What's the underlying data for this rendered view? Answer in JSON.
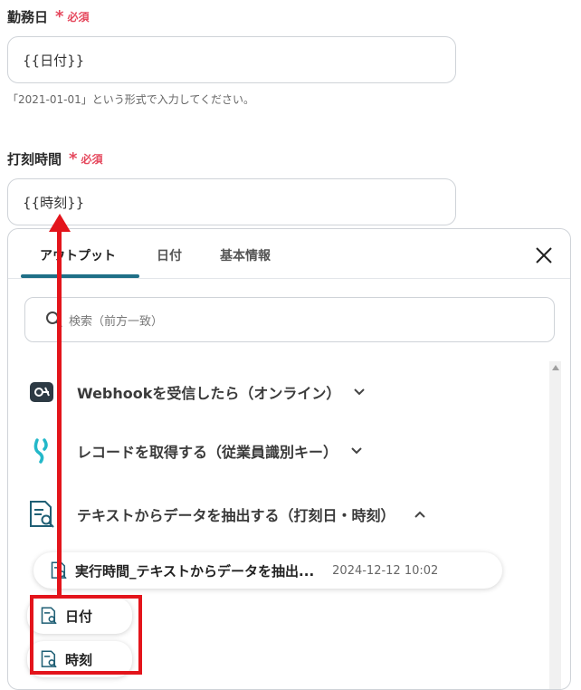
{
  "field1": {
    "label": "勤務日",
    "asterisk": "*",
    "required": "必須",
    "value": "{{日付}}",
    "hint": "「2021-01-01」という形式で入力してください。"
  },
  "field2": {
    "label": "打刻時間",
    "asterisk": "*",
    "required": "必須",
    "value": "{{時刻}}"
  },
  "panel": {
    "tabs": [
      "アウトプット",
      "日付",
      "基本情報"
    ],
    "active_tab": "アウトプット",
    "search_placeholder": "検索（前方一致）",
    "items": [
      {
        "label": "Webhookを受信したら（オンライン）",
        "icon": "webhook-icon"
      },
      {
        "label": "レコードを取得する（従業員識別キー）",
        "icon": "kintone-icon"
      },
      {
        "label": "テキストからデータを抽出する（打刻日・時刻）",
        "icon": "document-search-icon"
      }
    ],
    "output_card": {
      "title": "実行時間_テキストからデータを抽出...",
      "date": "2024-12-12 10:02"
    },
    "sub_items": [
      "日付",
      "時刻"
    ]
  },
  "colors": {
    "required": "#e5485d",
    "tab_underline": "#1f6f87",
    "annotation_red": "#e3141b"
  }
}
